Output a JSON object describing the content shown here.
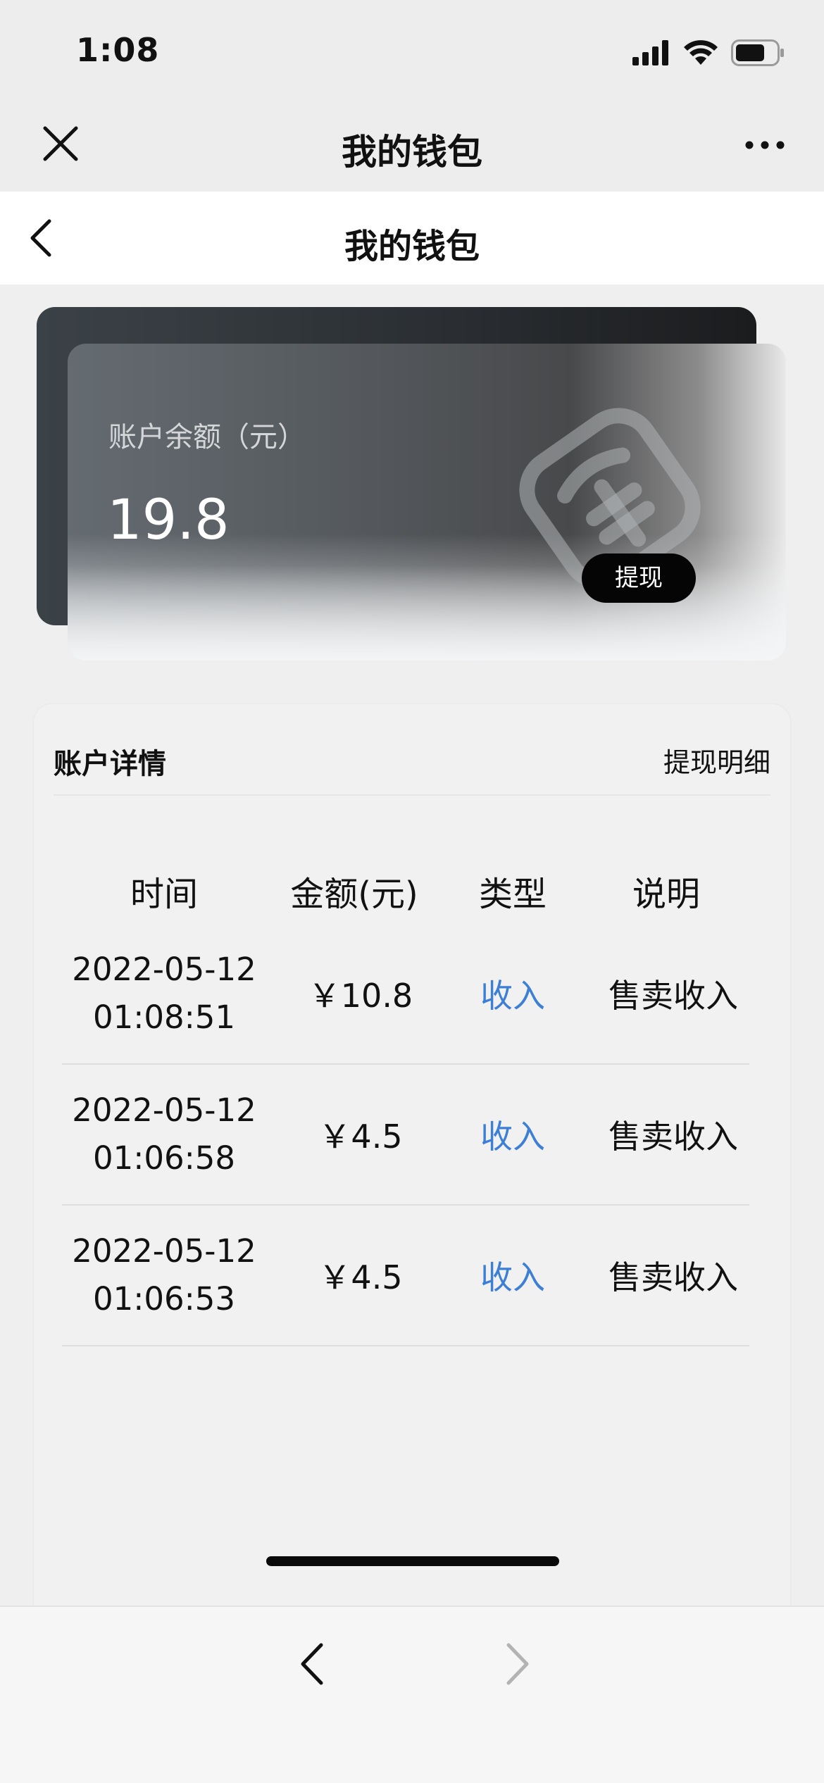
{
  "status_bar": {
    "time": "1:08"
  },
  "app_bar": {
    "title": "我的钱包"
  },
  "page_nav": {
    "title": "我的钱包"
  },
  "balance_card": {
    "label": "账户余额（元）",
    "value": "19.8",
    "withdraw_label": "提现"
  },
  "details": {
    "title": "账户详情",
    "link_label": "提现明细",
    "columns": [
      "时间",
      "金额(元)",
      "类型",
      "说明"
    ],
    "rows": [
      {
        "time": "2022-05-12\n01:08:51",
        "amount": "￥10.8",
        "type": "收入",
        "desc": "售卖收入"
      },
      {
        "time": "2022-05-12\n01:06:58",
        "amount": "￥4.5",
        "type": "收入",
        "desc": "售卖收入"
      },
      {
        "time": "2022-05-12\n01:06:53",
        "amount": "￥4.5",
        "type": "收入",
        "desc": "售卖收入"
      }
    ]
  },
  "colors": {
    "accent_link": "#3d7fd4",
    "button_bg": "#050505"
  },
  "icons": {
    "status": [
      "cellular-signal-icon",
      "wifi-icon",
      "battery-icon"
    ],
    "app_bar": [
      "close-icon",
      "more-icon"
    ],
    "nav": [
      "back-chevron-icon"
    ],
    "toolbar": [
      "back-arrow-icon",
      "forward-arrow-icon"
    ]
  }
}
